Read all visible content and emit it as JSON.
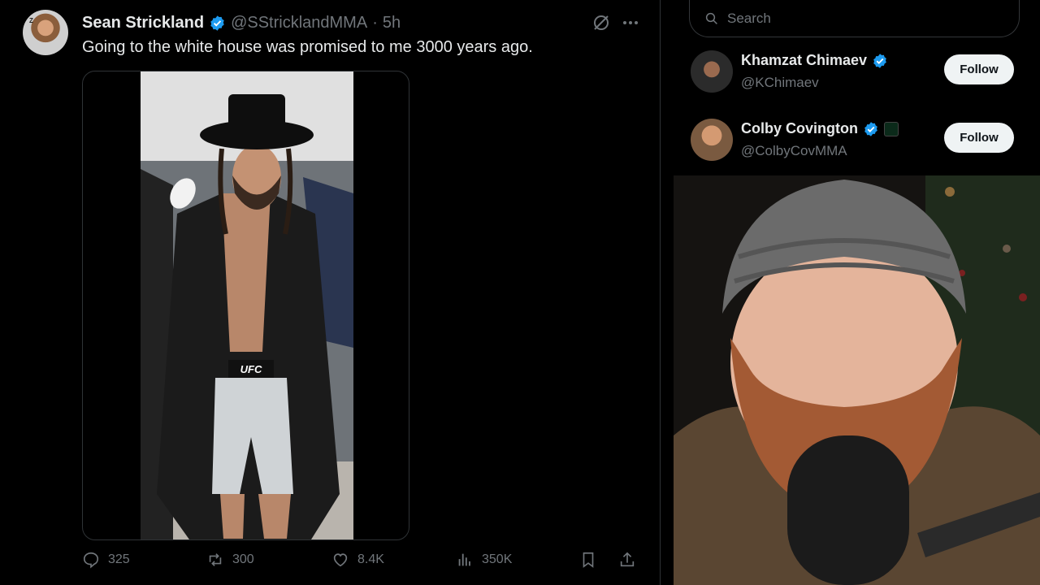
{
  "tweet": {
    "author_name": "Sean Strickland",
    "author_handle": "@SStricklandMMA",
    "separator": "·",
    "time": "5h",
    "text": "Going to the white house was promised to me 3000 years ago.",
    "media_label": "UFC"
  },
  "actions": {
    "replies": "325",
    "reposts": "300",
    "likes": "8.4K",
    "views": "350K"
  },
  "sidebar": {
    "search_placeholder": "Search",
    "who_to_follow": [
      {
        "name": "Khamzat Chimaev",
        "handle": "@KChimaev",
        "button": "Follow"
      },
      {
        "name": "Colby Covington",
        "handle": "@ColbyCovMMA",
        "button": "Follow"
      }
    ]
  },
  "colors": {
    "background": "#000000",
    "verified": "#1d9bf0",
    "muted": "#71767b",
    "text": "#e7e9ea"
  }
}
